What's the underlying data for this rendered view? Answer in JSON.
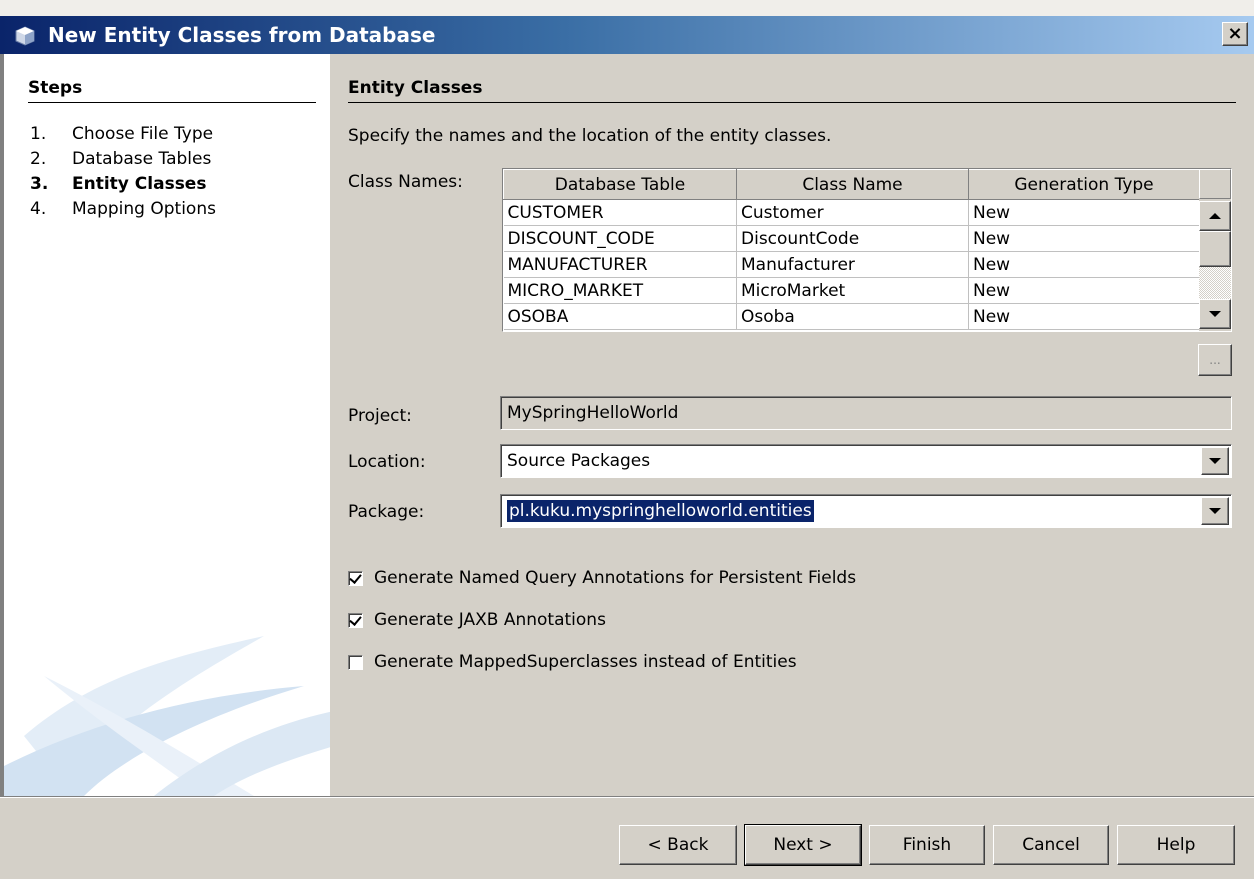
{
  "window": {
    "title": "New Entity Classes from Database",
    "close_label": "×"
  },
  "steps": {
    "title": "Steps",
    "items": [
      {
        "num": "1.",
        "label": "Choose File Type",
        "active": false
      },
      {
        "num": "2.",
        "label": "Database Tables",
        "active": false
      },
      {
        "num": "3.",
        "label": "Entity Classes",
        "active": true
      },
      {
        "num": "4.",
        "label": "Mapping Options",
        "active": false
      }
    ]
  },
  "main": {
    "title": "Entity Classes",
    "description": "Specify the names and the location of the entity classes.",
    "class_names_label": "Class Names:",
    "table": {
      "headers": [
        "Database Table",
        "Class Name",
        "Generation Type"
      ],
      "rows": [
        [
          "CUSTOMER",
          "Customer",
          "New"
        ],
        [
          "DISCOUNT_CODE",
          "DiscountCode",
          "New"
        ],
        [
          "MANUFACTURER",
          "Manufacturer",
          "New"
        ],
        [
          "MICRO_MARKET",
          "MicroMarket",
          "New"
        ],
        [
          "OSOBA",
          "Osoba",
          "New"
        ]
      ]
    },
    "ellipsis_label": "...",
    "project_label": "Project:",
    "project_value": "MySpringHelloWorld",
    "location_label": "Location:",
    "location_value": "Source Packages",
    "package_label": "Package:",
    "package_value": "pl.kuku.myspringhelloworld.entities",
    "checkboxes": [
      {
        "label": "Generate Named Query Annotations for Persistent Fields",
        "checked": true
      },
      {
        "label": "Generate JAXB Annotations",
        "checked": true
      },
      {
        "label": "Generate MappedSuperclasses instead of Entities",
        "checked": false
      }
    ]
  },
  "buttons": {
    "back": "< Back",
    "next": "Next >",
    "finish": "Finish",
    "cancel": "Cancel",
    "help": "Help"
  }
}
